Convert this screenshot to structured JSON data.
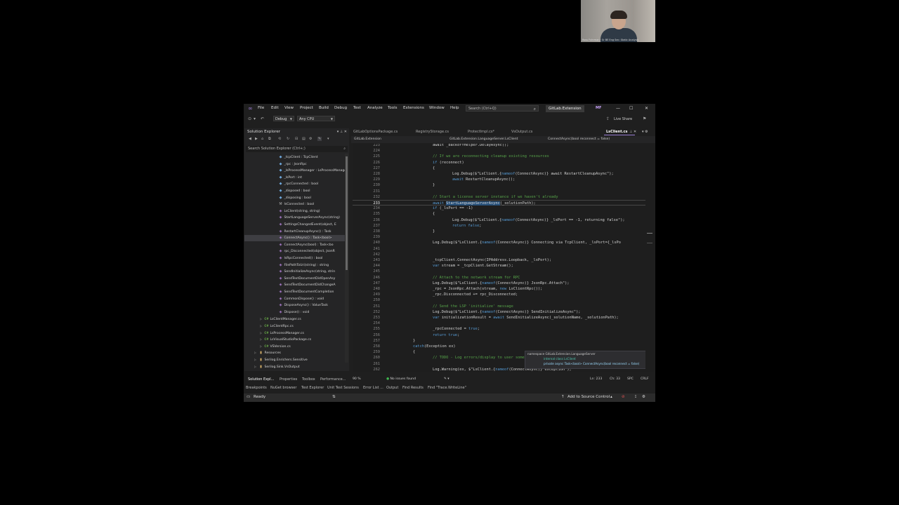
{
  "webcam": {
    "caption": "Ross Fuhrman · Sr BE Eng Sec: Static Analysis"
  },
  "window": {
    "menu": [
      "File",
      "Edit",
      "View",
      "Project",
      "Build",
      "Debug",
      "Test",
      "Analyze",
      "Tools",
      "Extensions",
      "Window",
      "Help"
    ],
    "search_placeholder": "Search (Ctrl+Q)",
    "solution_name": "GitLab.Extension",
    "avatar_initials": "MF"
  },
  "toolbar": {
    "config": "Debug",
    "platform": "Any CPU",
    "live_share": "Live Share"
  },
  "solution_explorer": {
    "title": "Solution Explorer",
    "search_placeholder": "Search Solution Explorer (Ctrl+;)",
    "items": [
      {
        "label": "_tcpClient : TcpClient",
        "kind": "field",
        "indent": 1
      },
      {
        "label": "_rpc : JsonRpc",
        "kind": "field",
        "indent": 1
      },
      {
        "label": "_lsProcessManager : LsProcessManager",
        "kind": "field",
        "indent": 1
      },
      {
        "label": "_lsPort : int",
        "kind": "field",
        "indent": 1
      },
      {
        "label": "_rpcConnected : bool",
        "kind": "field",
        "indent": 1
      },
      {
        "label": "_disposed : bool",
        "kind": "field",
        "indent": 1
      },
      {
        "label": "_disposing : bool",
        "kind": "field",
        "indent": 1
      },
      {
        "label": "IsConnected : bool",
        "kind": "prop",
        "indent": 1
      },
      {
        "label": "LsClient(string, string)",
        "kind": "method",
        "indent": 1
      },
      {
        "label": "StartLanguageServerAsync(string)",
        "kind": "method",
        "indent": 1
      },
      {
        "label": "SettingsChangedEvent(object, E",
        "kind": "method",
        "indent": 1
      },
      {
        "label": "RestartCleanupAsync() : Task",
        "kind": "method",
        "indent": 1
      },
      {
        "label": "ConnectAsync() : Task<bool>",
        "kind": "method",
        "indent": 1,
        "selected": true
      },
      {
        "label": "ConnectAsync(bool) : Task<bo",
        "kind": "method",
        "indent": 1
      },
      {
        "label": "rpc_Disconnected(object, JsonR",
        "kind": "method",
        "indent": 1
      },
      {
        "label": "IsRpcConnected() : bool",
        "kind": "method",
        "indent": 1
      },
      {
        "label": "FilePathToUri(string) : string",
        "kind": "method",
        "indent": 1
      },
      {
        "label": "SendInitializeAsync(string, strin",
        "kind": "method",
        "indent": 1
      },
      {
        "label": "SendTextDocumentDidOpenAsy",
        "kind": "method",
        "indent": 1
      },
      {
        "label": "SendTextDocumentDidChangeA",
        "kind": "method",
        "indent": 1
      },
      {
        "label": "SendTextDocumentCompletion",
        "kind": "method",
        "indent": 1
      },
      {
        "label": "CommonDispose() : void",
        "kind": "method",
        "indent": 1
      },
      {
        "label": "DisposeAsync() : ValueTask",
        "kind": "method",
        "indent": 1
      },
      {
        "label": "Dispose() : void",
        "kind": "method",
        "indent": 1
      },
      {
        "label": "LsClientManager.cs",
        "kind": "cs",
        "indent": 0
      },
      {
        "label": "LsClientRpc.cs",
        "kind": "cs",
        "indent": 0
      },
      {
        "label": "LsProcessManager.cs",
        "kind": "cs",
        "indent": 0
      },
      {
        "label": "LsVisualStudioPackage.cs",
        "kind": "cs",
        "indent": 0
      },
      {
        "label": "VSVersion.cs",
        "kind": "cs",
        "indent": 0
      },
      {
        "label": "Resources",
        "kind": "folder",
        "indent": -1
      },
      {
        "label": "Serilog.Enrichers.Sensitive",
        "kind": "folder",
        "indent": -1
      },
      {
        "label": "Serilog.Sink.VsOutput",
        "kind": "folder",
        "indent": -1
      }
    ],
    "bottom_tabs": [
      "Solution Expl...",
      "Properties",
      "Toolbox",
      "Performance..."
    ]
  },
  "editor": {
    "tabs": [
      {
        "label": "GitLabOptionsPackage.cs",
        "active": false
      },
      {
        "label": "RegistryStorage.cs",
        "active": false
      },
      {
        "label": "ProtectImpl.cs*",
        "active": false
      },
      {
        "label": "VsOutput.cs",
        "active": false
      },
      {
        "label": "LsClient.cs",
        "active": true
      }
    ],
    "nav": {
      "project": "GitLab.Extension",
      "type": "GitLab.Extension.LanguageServer.LsClient",
      "member": "ConnectAsync(bool reconnect = false)"
    },
    "current_line": 233,
    "lines": [
      {
        "n": 223,
        "s": [
          [
            "await _backoffHelper.DelayAsync();",
            ""
          ]
        ],
        "indent": 4
      },
      {
        "n": 224,
        "s": [],
        "indent": 0
      },
      {
        "n": 225,
        "s": [
          [
            "// If we are reconnecting cleanup existing resources",
            "cmt"
          ]
        ],
        "indent": 4
      },
      {
        "n": 226,
        "s": [
          [
            "if",
            "kw"
          ],
          [
            " (reconnect)",
            ""
          ]
        ],
        "indent": 4
      },
      {
        "n": 227,
        "s": [
          [
            "{",
            ""
          ]
        ],
        "indent": 4
      },
      {
        "n": 228,
        "s": [
          [
            "Log.Debug($\"LsClient.{",
            ""
          ],
          [
            "nameof",
            "nameof"
          ],
          [
            "(ConnectAsync)} await RestartCleanupAsync\");",
            ""
          ]
        ],
        "indent": 6
      },
      {
        "n": 229,
        "s": [
          [
            "await",
            "kw"
          ],
          [
            " RestartCleanupAsync();",
            ""
          ]
        ],
        "indent": 6
      },
      {
        "n": 230,
        "s": [
          [
            "}",
            ""
          ]
        ],
        "indent": 4
      },
      {
        "n": 231,
        "s": [],
        "indent": 0
      },
      {
        "n": 232,
        "s": [
          [
            "// Start a license server instance if we haven't already",
            "cmt"
          ]
        ],
        "indent": 4
      },
      {
        "n": 233,
        "s": [
          [
            "await",
            "kw"
          ],
          [
            " ",
            ""
          ],
          [
            "StartLanguageServerAsync",
            "hl"
          ],
          [
            "(_solutionPath);",
            ""
          ]
        ],
        "indent": 4
      },
      {
        "n": 234,
        "s": [
          [
            "if",
            "kw"
          ],
          [
            " (_lsPort == -1)",
            ""
          ]
        ],
        "indent": 4
      },
      {
        "n": 235,
        "s": [
          [
            "{",
            ""
          ]
        ],
        "indent": 4
      },
      {
        "n": 236,
        "s": [
          [
            "Log.Debug($\"LsClient.{",
            ""
          ],
          [
            "nameof",
            "nameof"
          ],
          [
            "(ConnectAsync)} _lsPort == -1, returning false\");",
            ""
          ]
        ],
        "indent": 6
      },
      {
        "n": 237,
        "s": [
          [
            "return",
            "kw"
          ],
          [
            " ",
            ""
          ],
          [
            "false",
            "kw"
          ],
          [
            ";",
            ""
          ]
        ],
        "indent": 6
      },
      {
        "n": 238,
        "s": [
          [
            "}",
            ""
          ]
        ],
        "indent": 4
      },
      {
        "n": 239,
        "s": [],
        "indent": 0
      },
      {
        "n": 240,
        "s": [
          [
            "Log.Debug($\"LsClient.{",
            ""
          ],
          [
            "nameof",
            "nameof"
          ],
          [
            "(ConnectAsync)} Connecting via TcpClient, _lsPort={_lsPo",
            ""
          ]
        ],
        "indent": 4
      },
      {
        "n": 241,
        "s": [],
        "indent": 0
      },
      {
        "n": 242,
        "s": [],
        "indent": 0
      },
      {
        "n": 243,
        "s": [
          [
            "_tcpClient.ConnectAsync(IPAddress.Loopback, _lsPort);",
            ""
          ]
        ],
        "indent": 4
      },
      {
        "n": 244,
        "s": [
          [
            "var",
            "kw"
          ],
          [
            " stream = _tcpClient.GetStream();",
            ""
          ]
        ],
        "indent": 4
      },
      {
        "n": 245,
        "s": [],
        "indent": 0
      },
      {
        "n": 246,
        "s": [
          [
            "// Attach to the network stream for RPC",
            "cmt"
          ]
        ],
        "indent": 4
      },
      {
        "n": 247,
        "s": [
          [
            "Log.Debug($\"LsClient.{",
            ""
          ],
          [
            "nameof",
            "nameof"
          ],
          [
            "(ConnectAsync)} JsonRpc.Attach\");",
            ""
          ]
        ],
        "indent": 4
      },
      {
        "n": 248,
        "s": [
          [
            "_rpc = JsonRpc.Attach(stream, ",
            ""
          ],
          [
            "new",
            "kw"
          ],
          [
            " LsClientRpc());",
            ""
          ]
        ],
        "indent": 4
      },
      {
        "n": 249,
        "s": [
          [
            "_rpc.Disconnected += rpc_Disconnected;",
            ""
          ]
        ],
        "indent": 4
      },
      {
        "n": 250,
        "s": [],
        "indent": 0
      },
      {
        "n": 251,
        "s": [
          [
            "// Send the LSP 'initialize' message",
            "cmt"
          ]
        ],
        "indent": 4
      },
      {
        "n": 252,
        "s": [
          [
            "Log.Debug($\"LsClient.{",
            ""
          ],
          [
            "nameof",
            "nameof"
          ],
          [
            "(ConnectAsync)} SendInitializeAsync\");",
            ""
          ]
        ],
        "indent": 4
      },
      {
        "n": 253,
        "s": [
          [
            "var",
            "kw"
          ],
          [
            " initializationResult = ",
            ""
          ],
          [
            "await",
            "kw"
          ],
          [
            " SendInitializeAsync(_solutionName, _solutionPath);",
            ""
          ]
        ],
        "indent": 4
      },
      {
        "n": 254,
        "s": [],
        "indent": 0
      },
      {
        "n": 255,
        "s": [
          [
            "_rpcConnected = ",
            ""
          ],
          [
            "true",
            "kw"
          ],
          [
            ";",
            ""
          ]
        ],
        "indent": 4
      },
      {
        "n": 256,
        "s": [
          [
            "return",
            "kw"
          ],
          [
            " ",
            ""
          ],
          [
            "true",
            "kw"
          ],
          [
            ";",
            ""
          ]
        ],
        "indent": 4
      },
      {
        "n": 257,
        "s": [
          [
            "}",
            ""
          ]
        ],
        "indent": 2
      },
      {
        "n": 258,
        "s": [
          [
            "catch",
            "kw"
          ],
          [
            "(Exception ex)",
            ""
          ]
        ],
        "indent": 2
      },
      {
        "n": 259,
        "s": [
          [
            "{",
            ""
          ]
        ],
        "indent": 2
      },
      {
        "n": 260,
        "s": [
          [
            "// TODO - Log errors/display to user somehow",
            "cmt"
          ]
        ],
        "indent": 4
      },
      {
        "n": 261,
        "s": [],
        "indent": 0
      },
      {
        "n": 262,
        "s": [
          [
            "Log.Warning(ex, $\"LsClient.{",
            ""
          ],
          [
            "nameof",
            "nameof"
          ],
          [
            "(ConnectAsync)} exception\");",
            ""
          ]
        ],
        "indent": 4
      },
      {
        "n": 263,
        "s": [],
        "indent": 0
      }
    ],
    "tooltip": {
      "line1": "namespace GitLab.Extension.LanguageServer",
      "line2": "internal class LsClient",
      "line3": "private async Task<bool> ConnectAsync(bool reconnect = false)"
    },
    "status": {
      "zoom": "90 %",
      "issues": "No issues found",
      "ln": "Ln: 233",
      "ch": "Ch: 33",
      "spc": "SPC",
      "crlf": "CRLF"
    }
  },
  "output_tabs": [
    "Breakpoints",
    "NuGet browser",
    "Test Explorer",
    "Unit Test Sessions",
    "Error List ...",
    "Output",
    "Find Results",
    "Find \"Trace.WriteLine\""
  ],
  "statusbar": {
    "ready": "Ready",
    "source_control": "Add to Source Control"
  }
}
